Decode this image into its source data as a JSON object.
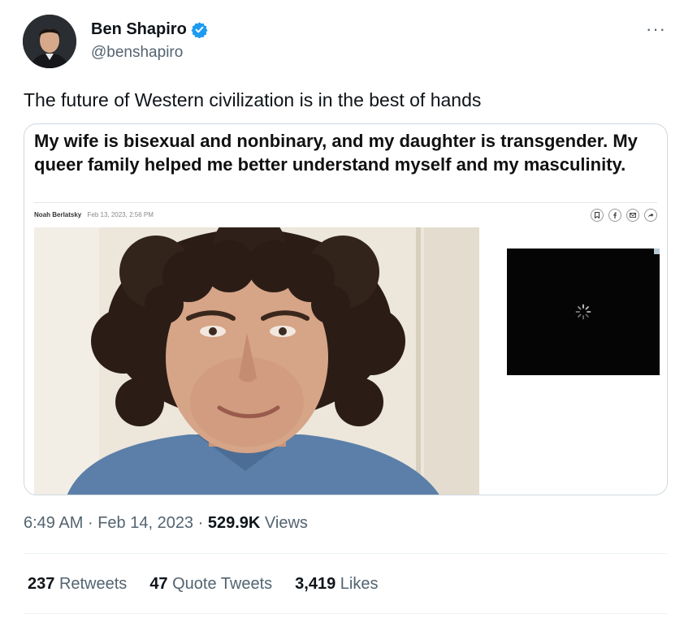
{
  "author": {
    "name": "Ben Shapiro",
    "handle": "@benshapiro",
    "verified": true,
    "verified_color": "#1d9bf0"
  },
  "more_label": "···",
  "tweet_text": "The future of Western civilization is in the best of hands",
  "card": {
    "headline": "My wife is bisexual and nonbinary, and my daughter is transgender. My queer family helped me better understand myself and my masculinity.",
    "byline_author": "Noah Berlatsky",
    "byline_date": "Feb 13, 2023, 2:56 PM",
    "share_icons": [
      "bookmark-icon",
      "facebook-icon",
      "email-icon",
      "share-icon"
    ]
  },
  "meta": {
    "time": "6:49 AM",
    "date": "Feb 14, 2023",
    "views_count": "529.9K",
    "views_label": "Views",
    "separator": "·"
  },
  "stats": {
    "retweets_count": "237",
    "retweets_label": "Retweets",
    "quotes_count": "47",
    "quotes_label": "Quote Tweets",
    "likes_count": "3,419",
    "likes_label": "Likes"
  }
}
